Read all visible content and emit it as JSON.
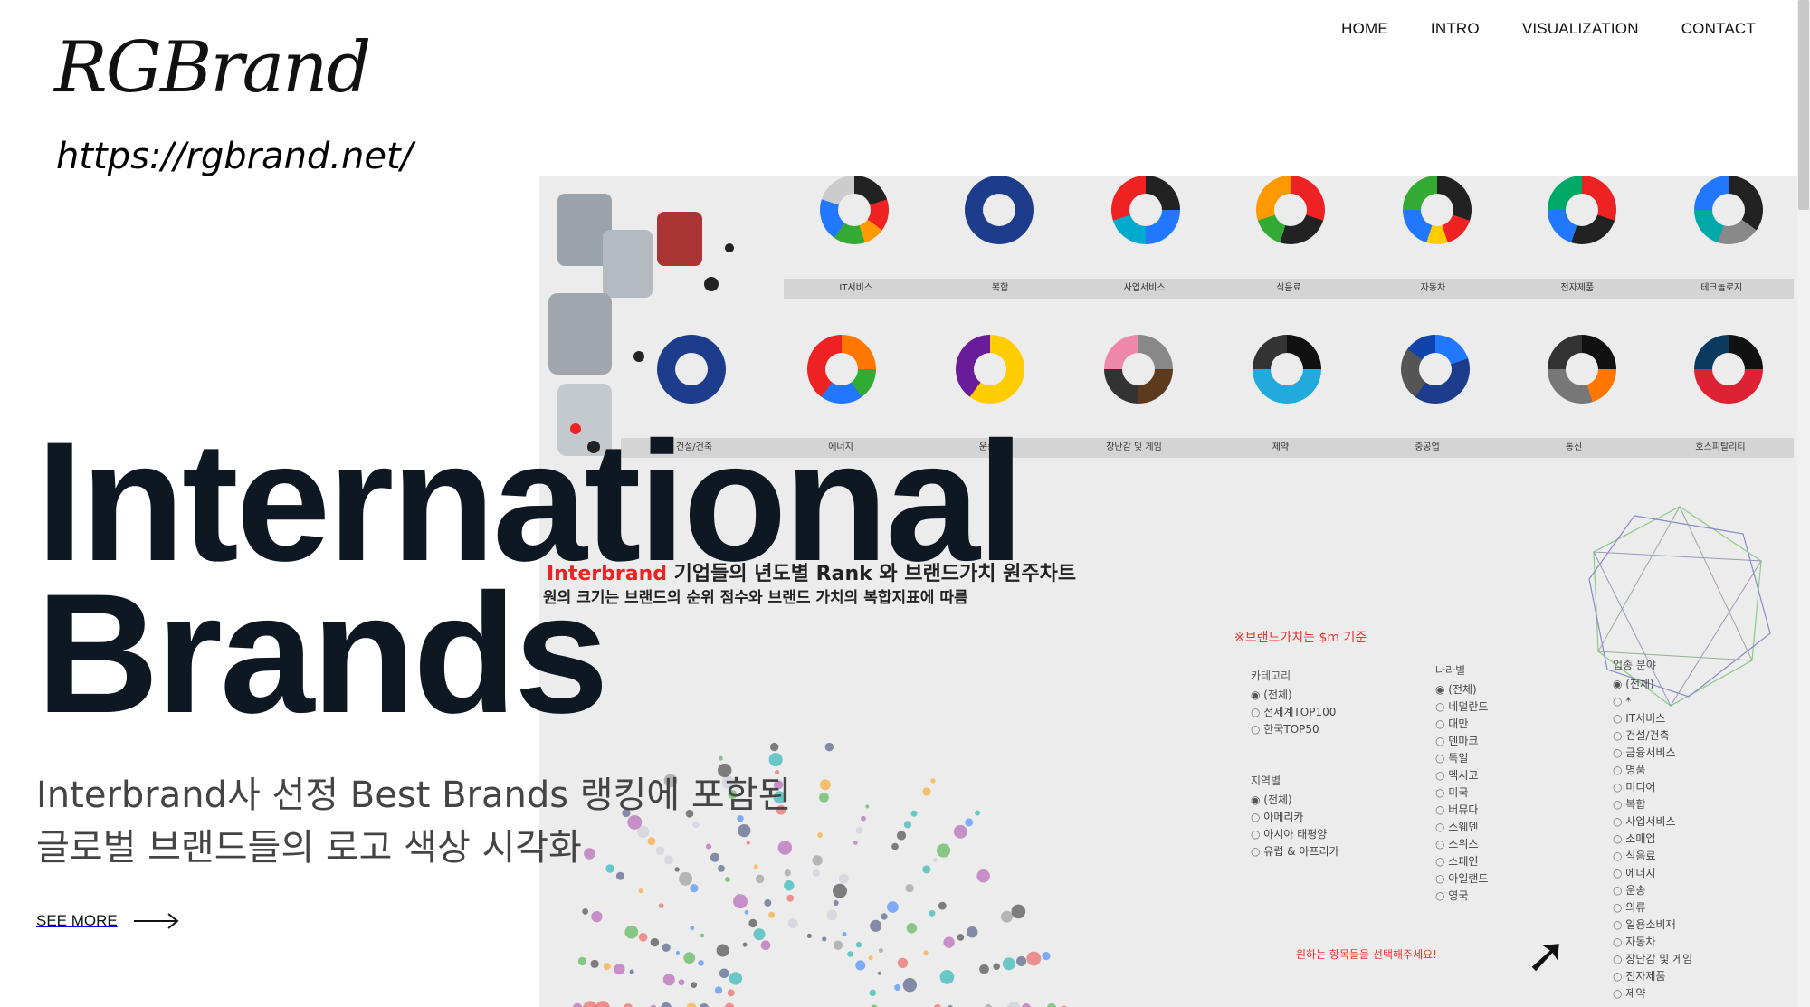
{
  "brand": {
    "logo_text": "RGBrand",
    "url": "https://rgbrand.net/"
  },
  "nav": {
    "items": [
      "HOME",
      "INTRO",
      "VISUALIZATION",
      "CONTACT"
    ]
  },
  "hero": {
    "title_line1": "International",
    "title_line2": "Brands",
    "subtitle_line1": "Interbrand사 선정 Best Brands 랭킹에 포함된",
    "subtitle_line2": "글로벌 브랜드들의 로고 색상 시각화",
    "cta": "SEE MORE"
  },
  "preview": {
    "row1_labels": [
      "IT서비스",
      "복합",
      "사업서비스",
      "식음료",
      "자동차",
      "전자제품",
      "테크놀로지"
    ],
    "row2_labels": [
      "건설/건축",
      "에너지",
      "운송",
      "장난감 및 게임",
      "제약",
      "중공업",
      "통신",
      "호스피탈리티"
    ],
    "chart_title_red": "Interbrand",
    "chart_title_rest": " 기업들의 년도별 Rank 와 브랜드가치 원주차트",
    "chart_subtitle": "원의 크기는 브랜드의 순위 점수와 브랜드 가치의 복합지표에 따름",
    "note": "※브랜드가치는 $m 기준",
    "category": {
      "title": "카테고리",
      "options": [
        "(전체)",
        "전세계TOP100",
        "한국TOP50"
      ]
    },
    "region": {
      "title": "지역별",
      "options": [
        "(전체)",
        "아메리카",
        "아시아 태평양",
        "유럽 & 아프리카"
      ]
    },
    "country": {
      "title": "나라별",
      "options": [
        "(전체)",
        "네덜란드",
        "대만",
        "덴마크",
        "독일",
        "멕시코",
        "미국",
        "버뮤다",
        "스웨덴",
        "스위스",
        "스페인",
        "아일랜드",
        "영국"
      ]
    },
    "industry": {
      "title": "업종 분야",
      "options": [
        "(전체)",
        "*",
        "IT서비스",
        "건설/건축",
        "금융서비스",
        "명품",
        "미디어",
        "복합",
        "사업서비스",
        "소매업",
        "식음료",
        "에너지",
        "운송",
        "의류",
        "일용소비재",
        "자동차",
        "장난감 및 게임",
        "전자제품",
        "제약"
      ]
    },
    "choose_text": "원하는 항목들을 선택해주세요!"
  },
  "colors": {
    "text_dark": "#0d1823",
    "accent_red": "#e22222",
    "panel_bg": "#ececec"
  }
}
